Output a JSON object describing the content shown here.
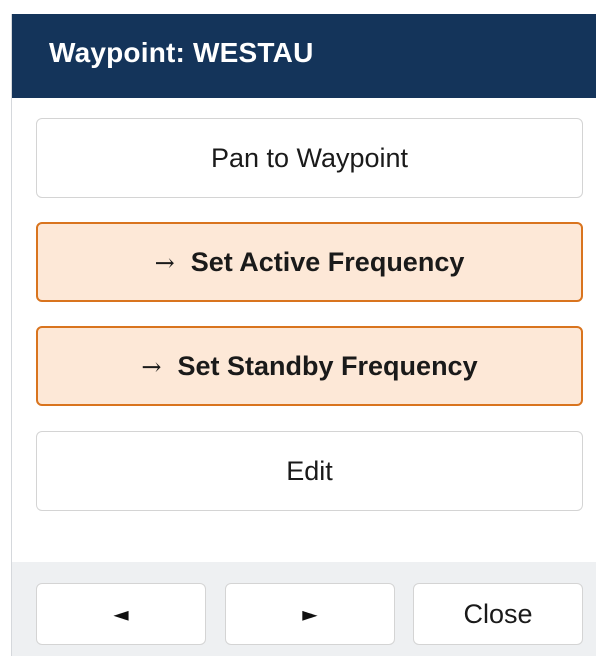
{
  "dialog": {
    "title": "Waypoint: WESTAU"
  },
  "actions": {
    "pan_label": "Pan to Waypoint",
    "active_arrow": "→",
    "active_label": "Set Active Frequency",
    "standby_arrow": "→",
    "standby_label": "Set Standby Frequency",
    "edit_label": "Edit"
  },
  "footer": {
    "prev_glyph": "◄",
    "next_glyph": "►",
    "close_label": "Close"
  },
  "colors": {
    "titlebar": "#14345a",
    "accent_border": "#d9741e",
    "accent_fill": "#fde8d7"
  },
  "icons": {
    "prev": "previous-icon",
    "next": "next-icon",
    "arrow": "right-arrow-icon"
  }
}
